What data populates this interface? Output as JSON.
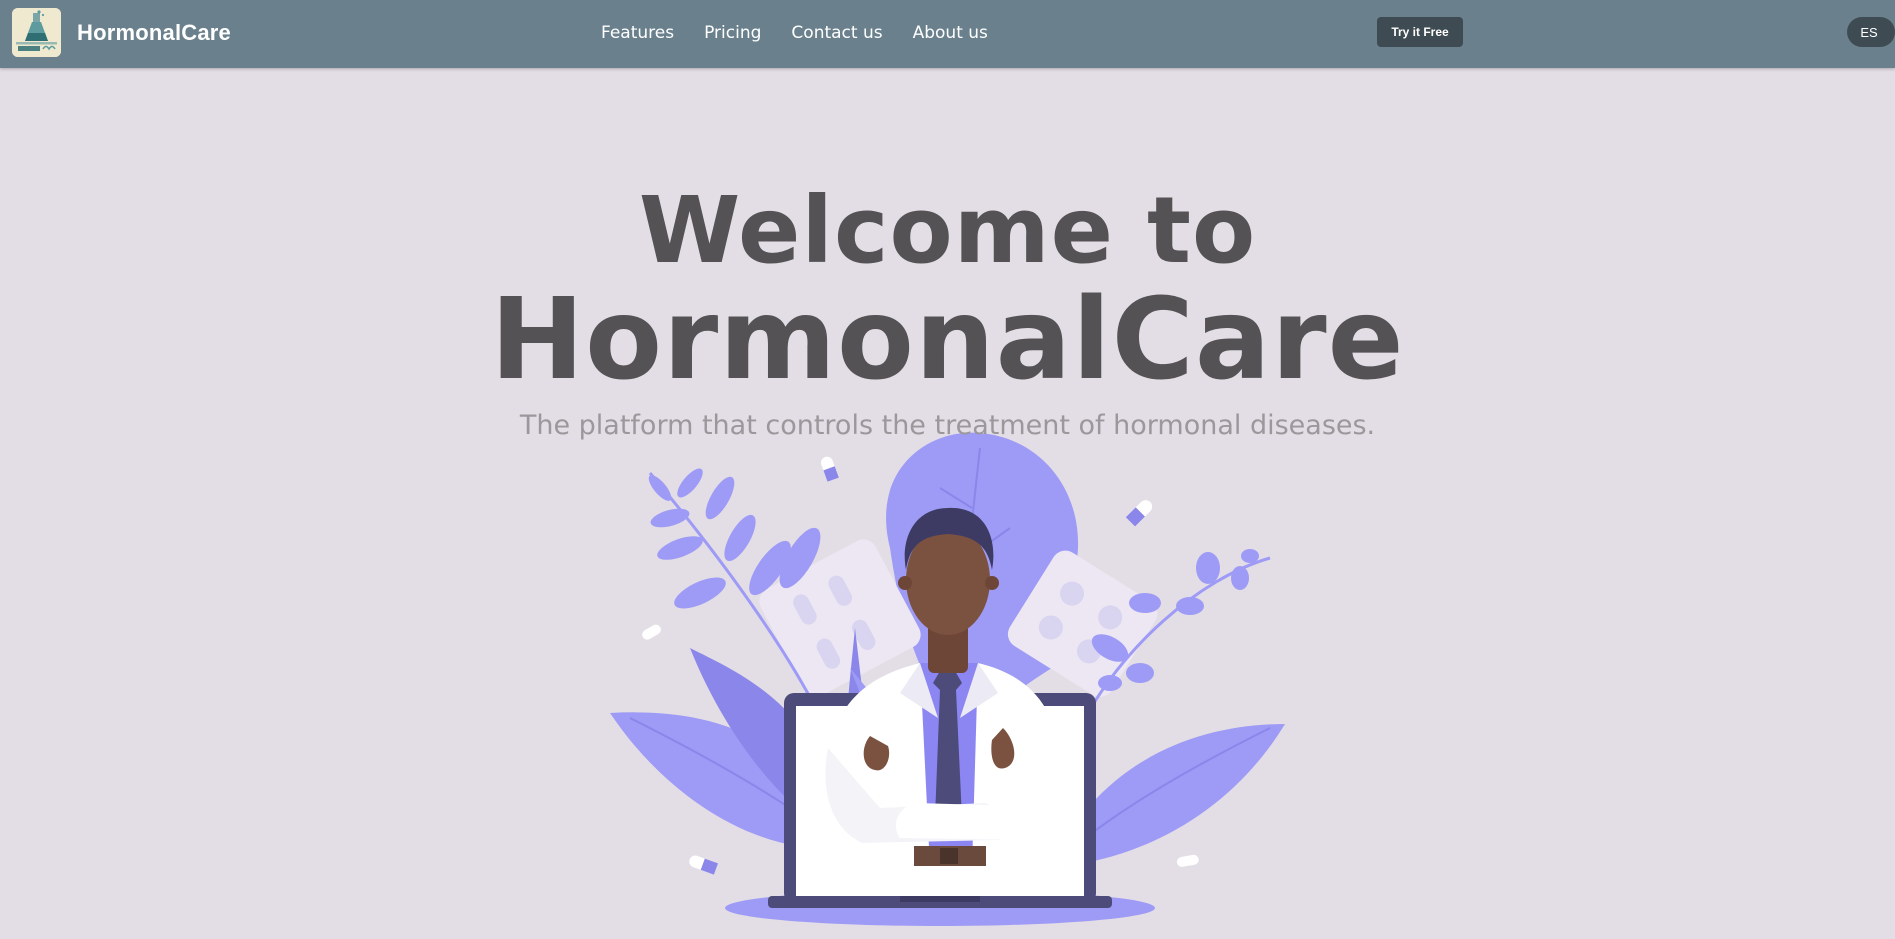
{
  "navbar": {
    "brand": "HormonalCare",
    "logo_icon": "flask-logo-icon",
    "links": [
      {
        "label": "Features"
      },
      {
        "label": "Pricing"
      },
      {
        "label": "Contact us"
      },
      {
        "label": "About us"
      }
    ],
    "cta_label": "Try it Free",
    "language_label": "ES"
  },
  "hero": {
    "title_line1": "Welcome to",
    "title_line2": "HormonalCare",
    "subtitle": "The platform that controls the treatment of hormonal diseases."
  },
  "illustration": {
    "icon": "doctor-on-laptop-illustration",
    "accent_color": "#9e9bf7"
  },
  "colors": {
    "navbar": "#6a818d",
    "background": "#e3dde5",
    "button": "#3e4b52",
    "title": "#545254",
    "subtitle": "#9b989c"
  }
}
